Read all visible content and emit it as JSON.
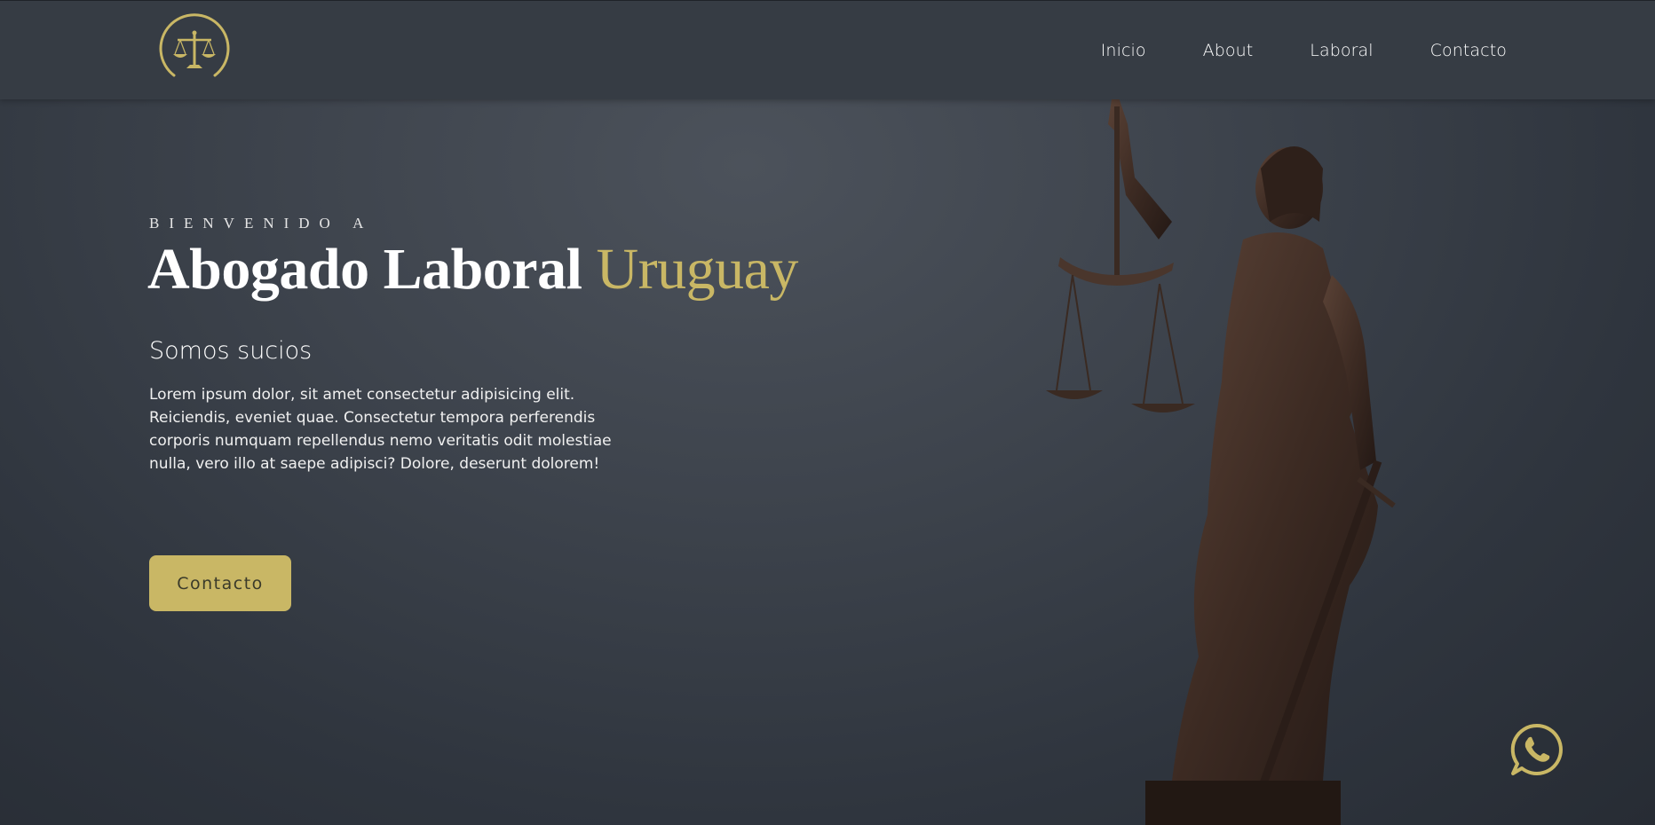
{
  "nav": {
    "logo_icon": "scales-of-justice-icon",
    "links": [
      "Inicio",
      "About",
      "Laboral",
      "Contacto"
    ]
  },
  "hero": {
    "eyebrow": "BIENVENIDO A",
    "title_main": "Abogado Laboral",
    "title_accent": "Uruguay",
    "subtitle": "Somos sucios",
    "paragraph": "Lorem ipsum dolor, sit amet consectetur adipisicing elit. Reiciendis, eveniet quae. Consectetur tempora perferendis corporis numquam repellendus nemo veritatis odit molestiae nulla, vero illo at saepe adipisci? Dolore, deserunt dolorem!",
    "cta_label": "Contacto",
    "image": "lady-justice-statue"
  },
  "floating": {
    "whatsapp_icon": "whatsapp-icon"
  },
  "colors": {
    "accent": "#c9b765",
    "nav_bg": "#363c44",
    "hero_bg": "#3e444d",
    "text": "#ffffff"
  }
}
